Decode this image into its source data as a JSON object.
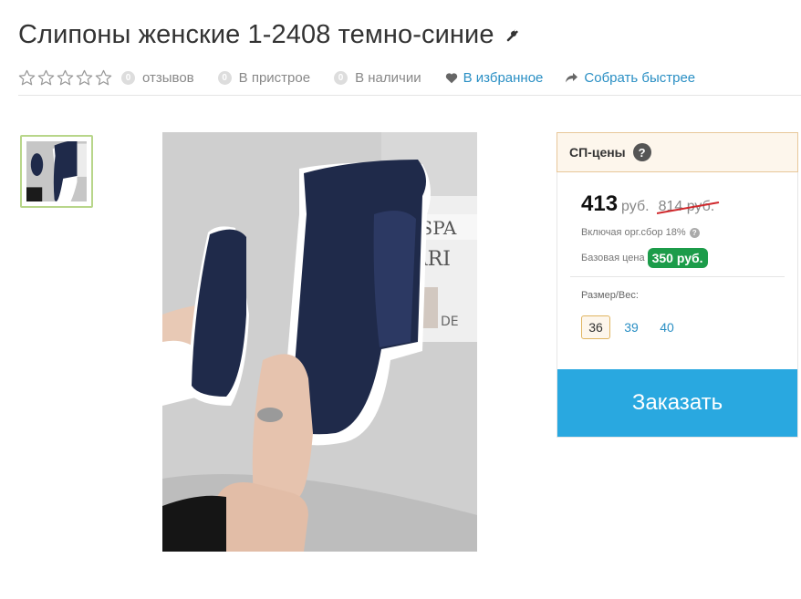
{
  "product": {
    "title": "Слипоны женские 1-2408 темно-синие",
    "edit_icon": "wrench-icon"
  },
  "meta": {
    "rating_stars": 0,
    "reviews": {
      "count": "0",
      "label": "отзывов"
    },
    "pristroy": {
      "count": "0",
      "label": "В пристрое"
    },
    "in_stock": {
      "count": "0",
      "label": "В наличии"
    },
    "favorite_label": "В избранное",
    "collect_label": "Собрать быстрее"
  },
  "price_box": {
    "header": "СП-цены",
    "header_help": "?",
    "price": "413",
    "currency": "руб.",
    "old_price": "814 руб.",
    "fee_text": "Включая орг.сбор 18%",
    "fee_help": "?",
    "base_label": "Базовая цена",
    "base_price": "350 руб.",
    "size_label": "Размер/Вес:",
    "sizes": [
      "36",
      "39",
      "40"
    ],
    "selected_size": "36",
    "order_label": "Заказать"
  },
  "colors": {
    "accent": "#29a8e0",
    "link": "#2a8fc4",
    "base_badge": "#1c9c4a",
    "strike": "#d0282c",
    "thumb_border": "#b8d68a"
  }
}
